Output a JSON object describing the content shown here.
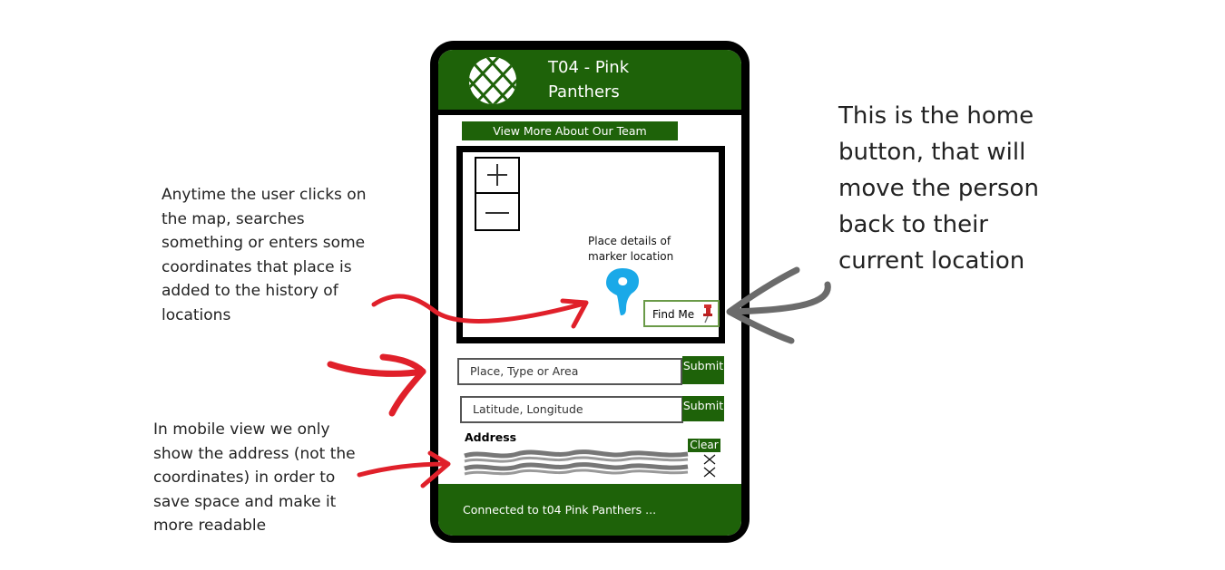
{
  "annotations": {
    "left_top": "Anytime the user clicks on the map, searches something or enters some coordinates that place is added to the history of locations",
    "left_bottom": "In mobile view we only show the address (not the coordinates) in order to save space and make it more readable",
    "right": "This is the home button, that will move the person back to their current location"
  },
  "app": {
    "title": "T04 - Pink Panthers",
    "view_more_label": "View More About Our Team",
    "map": {
      "place_details": "Place details of marker location",
      "find_me_label": "Find Me"
    },
    "search": {
      "place_placeholder": "Place, Type or Area",
      "coords_placeholder": "Latitude, Longitude",
      "submit_label": "Submit"
    },
    "address": {
      "label": "Address",
      "clear_label": "Clear"
    },
    "status": "Connected to t04 Pink Panthers ..."
  },
  "colors": {
    "brand_green": "#1e6209",
    "annotation_red": "#e0202a",
    "marker_blue": "#1aa9e8",
    "arrow_gray": "#6b6b6b"
  },
  "icons": [
    "logo-icon",
    "zoom-in-icon",
    "zoom-out-icon",
    "map-marker-icon",
    "pushpin-icon",
    "arrow-icon"
  ]
}
